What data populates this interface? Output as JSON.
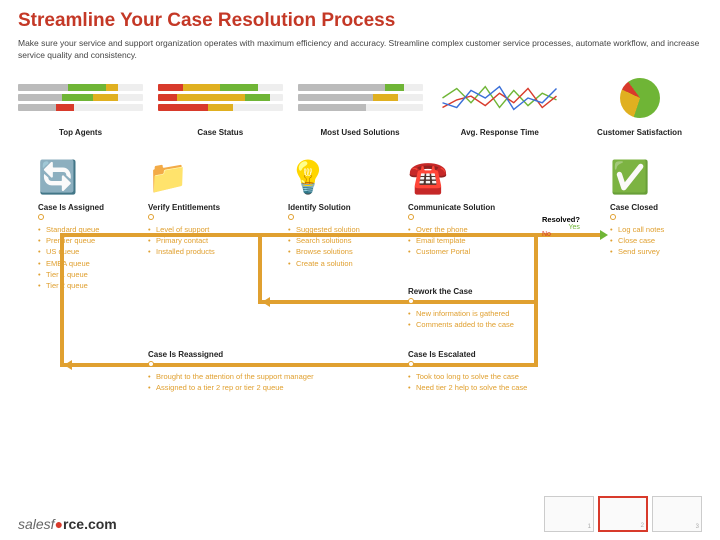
{
  "title": "Streamline Your Case Resolution Process",
  "subtitle": "Make sure your service and support organization operates with maximum efficiency and accuracy. Streamline complex customer service processes, automate workflow, and increase service quality and consistency.",
  "metrics": [
    {
      "label": "Top Agents"
    },
    {
      "label": "Case Status"
    },
    {
      "label": "Most Used Solutions"
    },
    {
      "label": "Avg. Response Time"
    },
    {
      "label": "Customer Satisfaction"
    }
  ],
  "steps": {
    "assigned": {
      "title": "Case Is Assigned",
      "items": [
        "Standard queue",
        "Premier queue",
        "US queue",
        "EMEA queue",
        "Tier 1 queue",
        "Tier 2 queue"
      ]
    },
    "verify": {
      "title": "Verify Entitlements",
      "items": [
        "Level of support",
        "Primary contact",
        "Installed products"
      ]
    },
    "identify": {
      "title": "Identify Solution",
      "items": [
        "Suggested solution",
        "Search solutions",
        "Browse solutions",
        "Create a solution"
      ]
    },
    "communicate": {
      "title": "Communicate Solution",
      "items": [
        "Over the phone",
        "Email template",
        "Customer Portal"
      ]
    },
    "resolved": {
      "q": "Resolved?",
      "yes": "Yes",
      "no": "No"
    },
    "closed": {
      "title": "Case Closed",
      "items": [
        "Log call notes",
        "Close case",
        "Send survey"
      ]
    },
    "rework": {
      "title": "Rework the Case",
      "items": [
        "New information is gathered",
        "Comments added to the case"
      ]
    },
    "reassigned": {
      "title": "Case Is Reassigned",
      "items": [
        "Brought to the attention of the support manager",
        "Assigned to a tier 2 rep or tier 2 queue"
      ]
    },
    "escalated": {
      "title": "Case Is Escalated",
      "items": [
        "Took too long to solve the case",
        "Need tier 2 help to solve the case"
      ]
    }
  },
  "logo_prefix": "salesf",
  "logo_suffix": "rce.com",
  "thumbs": [
    "1",
    "2",
    "3"
  ]
}
